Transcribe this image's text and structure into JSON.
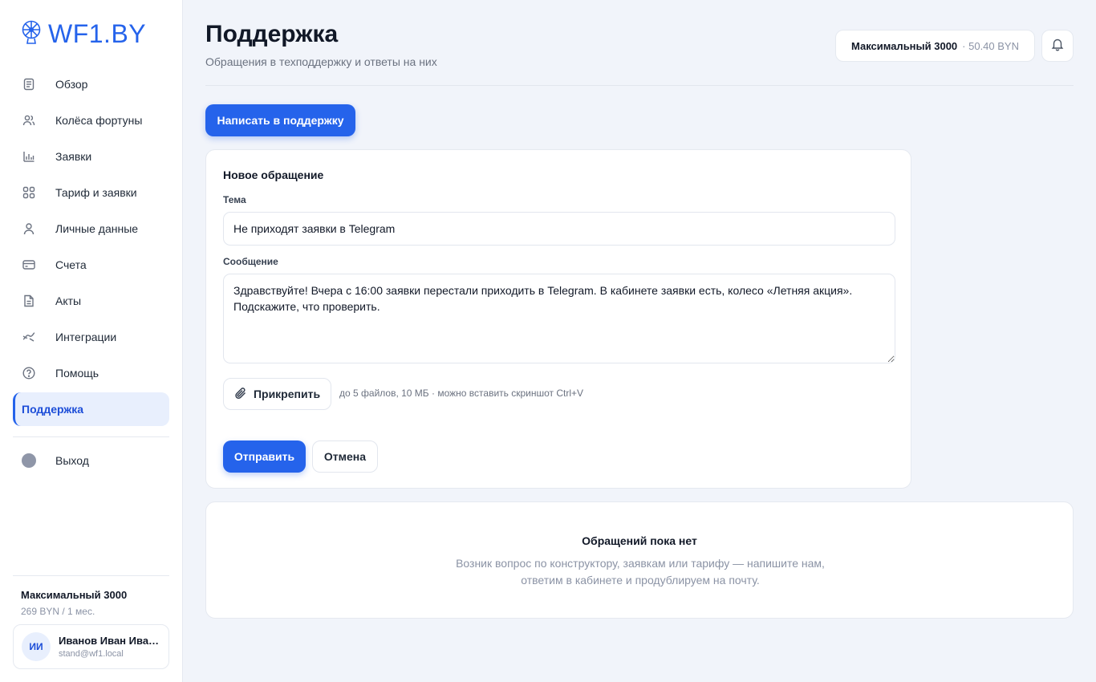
{
  "brand": {
    "logo_text": "WF1.BY",
    "accent": "#2563eb"
  },
  "sidebar": {
    "items": [
      {
        "label": "Обзор",
        "icon": "document-icon"
      },
      {
        "label": "Колёса фортуны",
        "icon": "users-icon"
      },
      {
        "label": "Заявки",
        "icon": "bar-chart-icon"
      },
      {
        "label": "Тариф и заявки",
        "icon": "grid-icon"
      },
      {
        "label": "Личные данные",
        "icon": "user-icon"
      },
      {
        "label": "Счета",
        "icon": "credit-card-icon"
      },
      {
        "label": "Акты",
        "icon": "file-icon"
      },
      {
        "label": "Интеграции",
        "icon": "link-icon"
      },
      {
        "label": "Помощь",
        "icon": "help-circle-icon"
      },
      {
        "label": "Поддержка",
        "icon": null,
        "active": true
      }
    ],
    "logout_label": "Выход",
    "plan": {
      "name": "Максимальный 3000",
      "price": "269 BYN / 1 мес."
    },
    "user": {
      "initials": "ИИ",
      "name": "Иванов Иван Иванович",
      "email": "stand@wf1.local"
    }
  },
  "header": {
    "title": "Поддержка",
    "subtitle": "Обращения в техподдержку и ответы на них",
    "plan_chip": {
      "name": "Максимальный 3000",
      "balance": "· 50.40 BYN"
    }
  },
  "actions": {
    "write_support": "Написать в поддержку"
  },
  "form": {
    "title": "Новое обращение",
    "subject_label": "Тема",
    "subject_value": "Не приходят заявки в Telegram",
    "message_label": "Сообщение",
    "message_value": "Здравствуйте! Вчера с 16:00 заявки перестали приходить в Telegram. В кабинете заявки есть, колесо «Летняя акция». Подскажите, что проверить.",
    "attach_label": "Прикрепить",
    "attach_hint": "до 5 файлов, 10 МБ · можно вставить скриншот Ctrl+V",
    "send_label": "Отправить",
    "cancel_label": "Отмена"
  },
  "empty_state": {
    "title": "Обращений пока нет",
    "text": "Возник вопрос по конструктору, заявкам или тарифу — напишите нам, ответим в кабинете и продублируем на почту."
  }
}
